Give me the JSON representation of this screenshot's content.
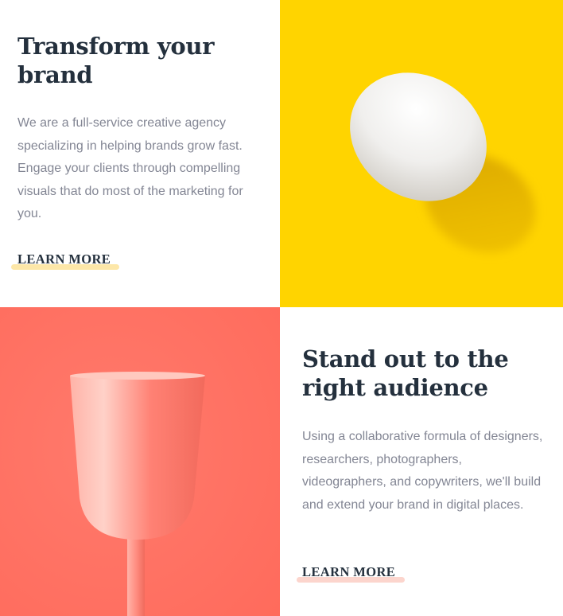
{
  "colors": {
    "heading": "#24303d",
    "body_text": "#838694",
    "yellow_panel": "#ffd400",
    "coral_panel": "#ff7466",
    "underline_yellow": "#fde7a8",
    "underline_coral": "#fcd5cd"
  },
  "sections": [
    {
      "heading_line1": "Transform your",
      "heading_line2": "brand",
      "body": "We are a full-service creative agency specializing in helping brands grow fast. Engage your clients through compelling visuals that do most of the marketing for you.",
      "cta_label": "LEARN MORE",
      "image": "white-egg-on-yellow"
    },
    {
      "heading_line1": "Stand out to the",
      "heading_line2": "right audience",
      "body": "Using a collaborative formula of designers, researchers, photographers, videographers, and copywriters, we'll build and extend your brand in digital places.",
      "cta_label": "LEARN MORE",
      "image": "coral-cup-on-coral"
    }
  ]
}
